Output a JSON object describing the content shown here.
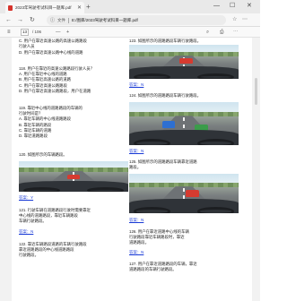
{
  "browser": {
    "tab_title": "2023年驾驶考试科目一题库.pdf",
    "new_tab": "+",
    "minimize": "—",
    "maximize": "☐",
    "close": "✕",
    "back": "←",
    "forward": "→",
    "refresh": "↻",
    "info_icon": "ⓘ",
    "file_label": "文件",
    "address": "E:/图库/2023驾驶考试科目一题库.pdf"
  },
  "pdf_toolbar": {
    "menu": "≡",
    "page_current": "13",
    "page_total": "/ 106",
    "zoom_out": "—",
    "zoom_in": "+"
  },
  "left_column": [
    {
      "type": "text",
      "lines": [
        "C. 用户在靠近高速公路的高速公路路段",
        "行驶人员"
      ]
    },
    {
      "type": "text",
      "lines": [
        "D. 用户在靠近高速公路中心线的道路"
      ]
    },
    {
      "type": "text",
      "lines": [
        "118. 用户在靠近的高速公路路段行驶人员？",
        "A. 用户在靠近中心线的道路",
        "B. 用户在靠近高速公路的道路",
        "C. 用户在靠近高速公路路段",
        "D. 用户在靠近高速公路路段，用户在道路"
      ]
    },
    {
      "type": "text",
      "lines": [
        "119. 靠近中心线的道路路段的车辆的",
        "行驶时间是？",
        "A. 靠近车辆的中心线道路路段",
        "B. 靠近车辆的路段",
        "C. 靠近车辆的道路",
        "D. 靠近道路路段"
      ]
    },
    {
      "type": "text",
      "lines": [
        "120. 如图所示的车辆路段。"
      ]
    },
    {
      "type": "answer",
      "label": "答案：Y"
    },
    {
      "type": "text",
      "lines": [
        "121. 行驶车辆在道路路段行驶时需要靠近",
        "中心线的道路路段，靠近车辆路段",
        "车辆行驶路段。"
      ]
    },
    {
      "type": "answer",
      "label": "答案：N"
    },
    {
      "type": "text",
      "lines": [
        "122. 靠近车辆路段道路的车辆行驶路段",
        "靠近道路路段的中心线道路路段",
        "行驶路段。"
      ]
    }
  ],
  "right_column": [
    {
      "type": "text",
      "lines": [
        "123. 如图所示的道路路段车辆行驶路段。"
      ]
    },
    {
      "type": "answer",
      "label": "答案：N"
    },
    {
      "type": "text",
      "lines": [
        "124. 如图所示的道路路段车辆行驶路段。"
      ]
    },
    {
      "type": "answer",
      "label": "答案：N"
    },
    {
      "type": "text",
      "lines": [
        "125. 如图所示的道路路段车辆靠近道路",
        "路段。"
      ]
    },
    {
      "type": "answer",
      "label": "答案：N"
    },
    {
      "type": "text",
      "lines": [
        "126. 用户在靠近道路中心线的车辆",
        "行驶路段靠近车辆路段时，靠近",
        "道路路段。"
      ]
    },
    {
      "type": "answer",
      "label": "答案：N"
    },
    {
      "type": "text",
      "lines": [
        "127. 用户在靠近道路路段的车辆，靠近",
        "道路路段的车辆行驶路段。"
      ]
    }
  ],
  "colors": {
    "answer_blue": "#1a3bd6",
    "tab_bar": "#e9e9e9",
    "pdf_icon_red": "#d63b30"
  }
}
